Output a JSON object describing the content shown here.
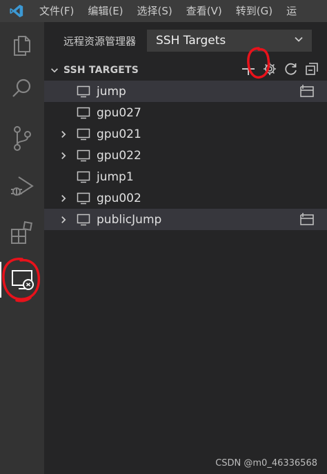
{
  "menu": {
    "items": [
      "文件(F)",
      "编辑(E)",
      "选择(S)",
      "查看(V)",
      "转到(G)",
      "运"
    ]
  },
  "explorer": {
    "panel_title": "远程资源管理器",
    "dropdown_value": "SSH Targets",
    "section_title": "SSH TARGETS"
  },
  "hosts": [
    {
      "label": "jump",
      "expandable": false,
      "selected": true,
      "show_action": true
    },
    {
      "label": "gpu027",
      "expandable": false,
      "selected": false,
      "show_action": false
    },
    {
      "label": "gpu021",
      "expandable": true,
      "selected": false,
      "show_action": false
    },
    {
      "label": "gpu022",
      "expandable": true,
      "selected": false,
      "show_action": false
    },
    {
      "label": "jump1",
      "expandable": false,
      "selected": false,
      "show_action": false
    },
    {
      "label": "gpu002",
      "expandable": true,
      "selected": false,
      "show_action": false
    },
    {
      "label": "publicJump",
      "expandable": true,
      "selected": true,
      "show_action": true
    }
  ],
  "watermark": "CSDN @m0_46336568",
  "colors": {
    "accent_blue": "#3c99d4",
    "annotation_red": "#e8121b",
    "icon_gray": "#c5c5c5"
  },
  "icons": {
    "activity_bar": [
      "explorer-icon",
      "search-icon",
      "source-control-icon",
      "run-debug-icon",
      "extensions-icon",
      "remote-explorer-icon"
    ],
    "section_actions": [
      "add-icon",
      "gear-icon",
      "refresh-icon",
      "collapse-all-icon"
    ]
  }
}
